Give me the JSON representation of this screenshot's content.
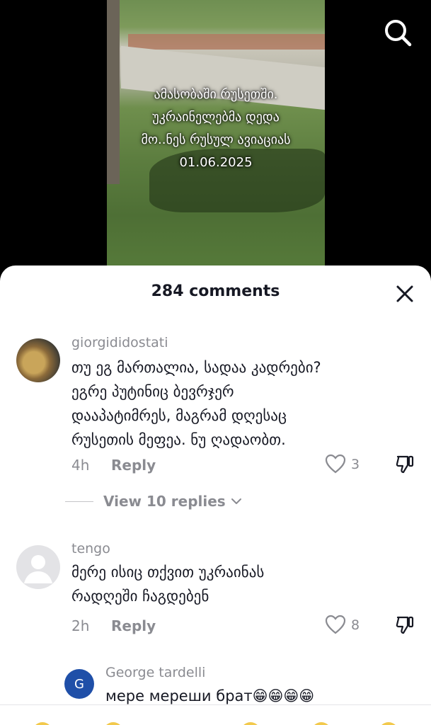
{
  "video": {
    "caption_lines": [
      "ამასობაში რუსეთში.",
      "უკრაინელებმა დედა",
      "მო..ნეს რუსულ ავიაციას",
      "01.06.2025"
    ]
  },
  "icons": {
    "search": "search-icon",
    "close": "close-icon",
    "like": "heart-icon",
    "dislike": "dislike-icon",
    "chevron": "chevron-down-icon"
  },
  "sheet": {
    "title": "284 comments"
  },
  "comments": [
    {
      "username": "giorgididostati",
      "lines": [
        "თუ ეგ მართალია, სადაა კადრები?",
        "ეგრე პუტინიც ბევრჯერ",
        "დააპატიმრეს, მაგრამ დღესაც",
        "რუსეთის მეფეა. ნუ ღადაობთ."
      ],
      "time": "4h",
      "reply_label": "Reply",
      "likes": "3"
    },
    {
      "username": "tengo",
      "lines": [
        "მერე ისიც თქვით უკრაინას",
        "რადღეში ჩაგდებენ"
      ],
      "time": "2h",
      "reply_label": "Reply",
      "likes": "8"
    }
  ],
  "view_replies": "View 10 replies",
  "reply": {
    "avatar_letter": "G",
    "username": "George tardelli",
    "text": "мере мереши брат😁😁😁😁"
  },
  "colors": {
    "accent_text": "#161823",
    "muted": "#8a8b91",
    "avatar_blue": "#1f4fa8"
  }
}
